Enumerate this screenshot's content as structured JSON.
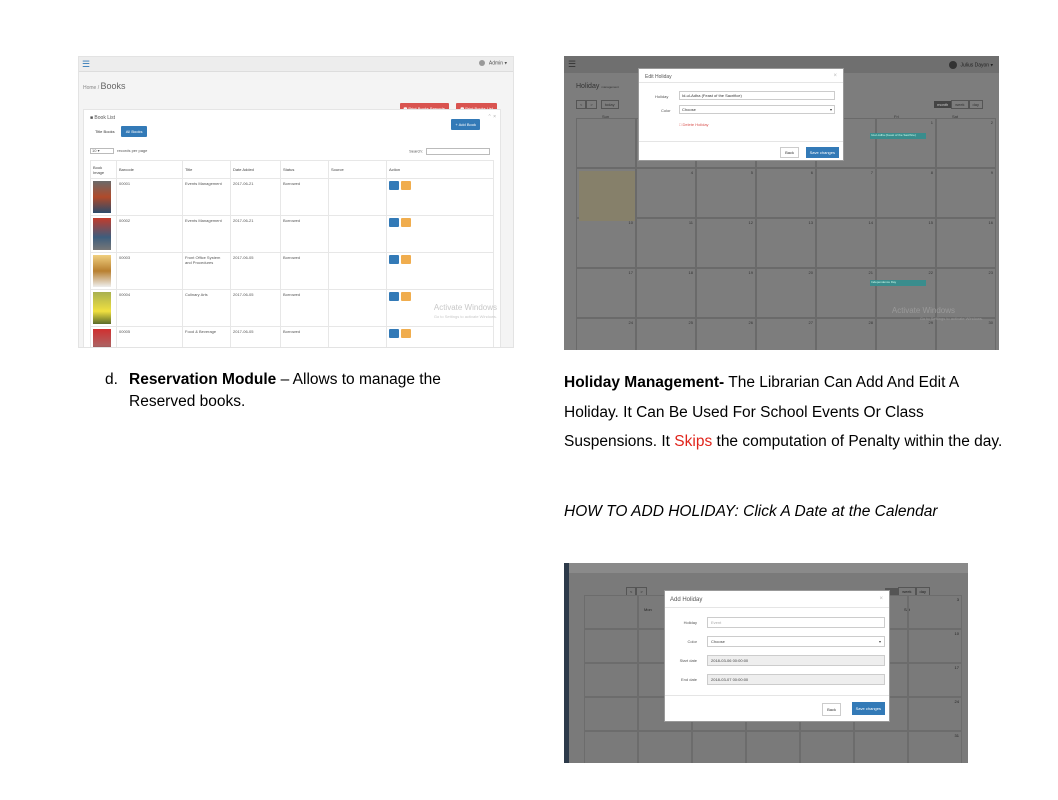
{
  "books_screenshot": {
    "user": "Admin",
    "breadcrumb_home": "Home /",
    "page_title": "Books",
    "print_barcode": "Print Books Barcode",
    "print_list": "Print Books List",
    "panel_title": "Book List",
    "add_book": "Add Book",
    "tab_title_books": "Title Books",
    "tab_all_books": "All Books",
    "records_select": "10",
    "records_label": "records per page",
    "search_label": "Search:",
    "columns": [
      "Book Image",
      "Barcode",
      "Title",
      "Date Added",
      "Status",
      "Source",
      "Action"
    ],
    "rows": [
      [
        "00001",
        "Events Management",
        "2017-06-21",
        "Borrowed",
        ""
      ],
      [
        "00002",
        "Events Management",
        "2017-06-21",
        "Borrowed",
        ""
      ],
      [
        "00003",
        "Front Office System and Procedures",
        "2017-06-05",
        "Borrowed",
        ""
      ],
      [
        "00004",
        "Culinary Arts",
        "2017-06-05",
        "Borrowed",
        ""
      ],
      [
        "00005",
        "Food & Beverage",
        "2017-06-05",
        "Borrowed",
        ""
      ]
    ],
    "watermark_title": "Activate Windows",
    "watermark_sub": "Go to Settings to activate Windows."
  },
  "edit_holiday_screenshot": {
    "user": "Julius Dayon",
    "calendar_title": "Holiday",
    "calendar_subtitle": "management",
    "weekday_sun": "Sun",
    "weekday_fri": "Fri",
    "weekday_sat": "Sat",
    "view_month": "month",
    "view_week": "week",
    "view_day": "day",
    "today_button": "today",
    "modal_title": "Edit Holiday",
    "holiday_label": "Holiday",
    "holiday_value": "Id-ul-Adha (Feast of the Sacrifice)",
    "color_label": "Color",
    "color_value": "Choose",
    "delete_label": "Delete Holiday",
    "back_button": "Back",
    "save_button": "Save changes",
    "event_1": "Id-ul-Adha (Feast of the Sacrifice)",
    "event_2": "Independence Day",
    "days": [
      "1",
      "2",
      "3",
      "4",
      "5",
      "6",
      "7",
      "8",
      "9",
      "10",
      "11",
      "12",
      "13",
      "14",
      "15",
      "16",
      "17",
      "18",
      "19",
      "20",
      "21",
      "22",
      "23",
      "24",
      "25",
      "26",
      "27",
      "28",
      "29",
      "30"
    ],
    "watermark_title": "Activate Windows",
    "watermark_sub": "Go to Settings to activate Windows."
  },
  "reservation": {
    "marker": "d.",
    "title": "Reservation Module",
    "description": " – Allows to manage the Reserved books."
  },
  "holiday_management": {
    "title": "Holiday Management-",
    "text_before": " The Librarian Can Add And Edit A Holiday. It Can Be Used For School Events Or Class Suspensions. It ",
    "highlight": "Skips",
    "text_after": " the computation of Penalty within the day.",
    "highlight_color": "#e0241b",
    "how_to": "HOW TO ADD HOLIDAY: Click A Date at the Calendar"
  },
  "add_holiday_screenshot": {
    "view_week": "week",
    "view_day": "day",
    "weekday_mon": "Mon",
    "weekday_sat": "Sat",
    "modal_title": "Add Holiday",
    "holiday_label": "Holiday",
    "holiday_placeholder": "Event",
    "color_label": "Color",
    "color_value": "Choose",
    "start_label": "Start date",
    "start_value": "2018-03-06 00:00:00",
    "end_label": "End date",
    "end_value": "2018-03-07 00:00:00",
    "back_button": "Back",
    "save_button": "Save changes",
    "day_numbers": [
      "3",
      "10",
      "17",
      "24",
      "31"
    ]
  }
}
